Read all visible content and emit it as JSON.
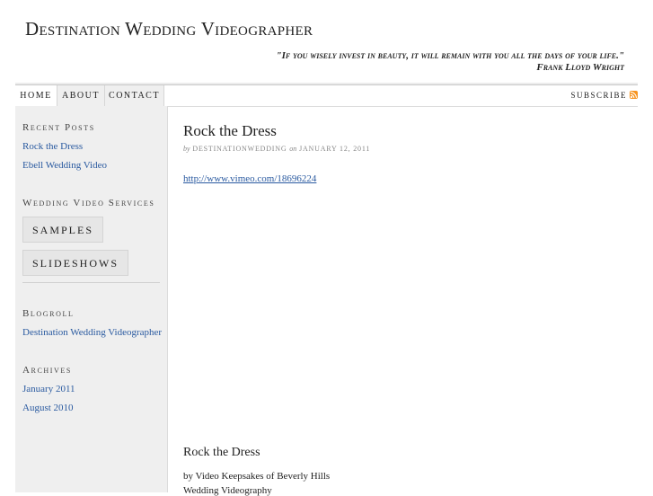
{
  "site": {
    "title": "Destination Wedding Videographer",
    "quote": "\"If you wisely invest in beauty, it will remain with you all the days of your life.\"",
    "quote_author": "Frank Lloyd Wright"
  },
  "nav": {
    "tabs": [
      {
        "label": "Home",
        "active": true
      },
      {
        "label": "About",
        "active": false
      },
      {
        "label": "Contact",
        "active": false
      }
    ],
    "subscribe_label": "Subscribe",
    "subscribe_icon": "rss-icon"
  },
  "sidebar": {
    "recent_posts": {
      "title": "Recent Posts",
      "items": [
        "Rock the Dress",
        "Ebell Wedding Video"
      ]
    },
    "services": {
      "title": "Wedding Video Services",
      "buttons": [
        "Samples",
        "Slideshows"
      ]
    },
    "blogroll": {
      "title": "Blogroll",
      "items": [
        "Destination Wedding Videographer"
      ]
    },
    "archives": {
      "title": "Archives",
      "items": [
        "January 2011",
        "August 2010"
      ]
    }
  },
  "post": {
    "title": "Rock the Dress",
    "meta_by": "by",
    "author": "destinationwedding",
    "meta_on": "on",
    "date": "January 12, 2011",
    "link": "http://www.vimeo.com/18696224",
    "subtitle": "Rock the Dress",
    "byline": "by Video Keepsakes of Beverly Hills",
    "byline_2": "Wedding Videography"
  },
  "colors": {
    "link": "#2a5aa0",
    "sidebar_bg": "#efefef",
    "rss": "#f7931e"
  }
}
